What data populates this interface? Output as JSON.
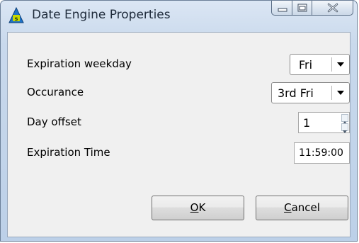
{
  "window": {
    "title": "Date Engine Properties",
    "icon": "app-icon"
  },
  "fields": {
    "expiration_weekday": {
      "label": "Expiration weekday",
      "value": "Fri"
    },
    "occurance": {
      "label": "Occurance",
      "value": "3rd Fri"
    },
    "day_offset": {
      "label": "Day offset",
      "value": "1"
    },
    "expiration_time": {
      "label": "Expiration Time",
      "value": "11:59:00"
    }
  },
  "buttons": {
    "ok": {
      "mnemonic": "O",
      "rest": "K"
    },
    "cancel": {
      "mnemonic": "C",
      "rest": "ancel"
    }
  }
}
